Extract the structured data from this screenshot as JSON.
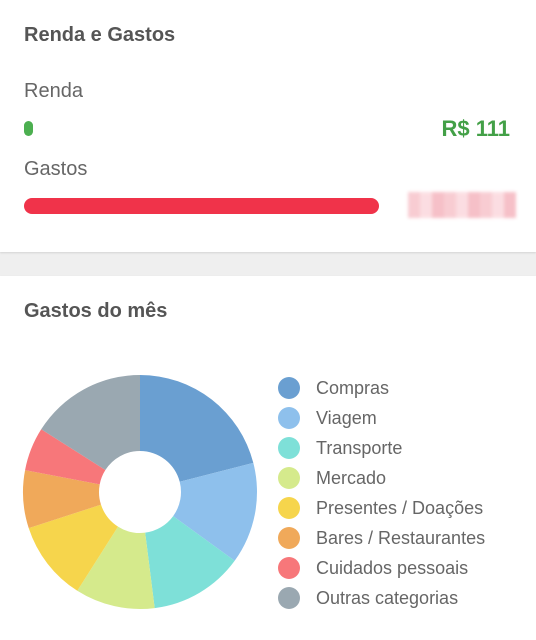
{
  "income_card": {
    "title": "Renda e Gastos",
    "income_label": "Renda",
    "income_value": "R$ 111",
    "expense_label": "Gastos"
  },
  "month_card": {
    "title": "Gastos do mês",
    "legend": [
      {
        "label": "Compras",
        "color": "#6a9fd1"
      },
      {
        "label": "Viagem",
        "color": "#8ec0ec"
      },
      {
        "label": "Transporte",
        "color": "#7ee0d8"
      },
      {
        "label": "Mercado",
        "color": "#d5ea8c"
      },
      {
        "label": "Presentes / Doações",
        "color": "#f6d54c"
      },
      {
        "label": "Bares / Restaurantes",
        "color": "#f0a95a"
      },
      {
        "label": "Cuidados pessoais",
        "color": "#f7777a"
      },
      {
        "label": "Outras categorias",
        "color": "#9aa8b1"
      }
    ]
  },
  "chart_data": {
    "type": "pie",
    "categories": [
      "Compras",
      "Viagem",
      "Transporte",
      "Mercado",
      "Presentes / Doações",
      "Bares / Restaurantes",
      "Cuidados pessoais",
      "Outras categorias"
    ],
    "values": [
      21,
      14,
      13,
      11,
      11,
      8,
      6,
      16
    ],
    "colors": [
      "#6a9fd1",
      "#8ec0ec",
      "#7ee0d8",
      "#d5ea8c",
      "#f6d54c",
      "#f0a95a",
      "#f7777a",
      "#9aa8b1"
    ]
  }
}
